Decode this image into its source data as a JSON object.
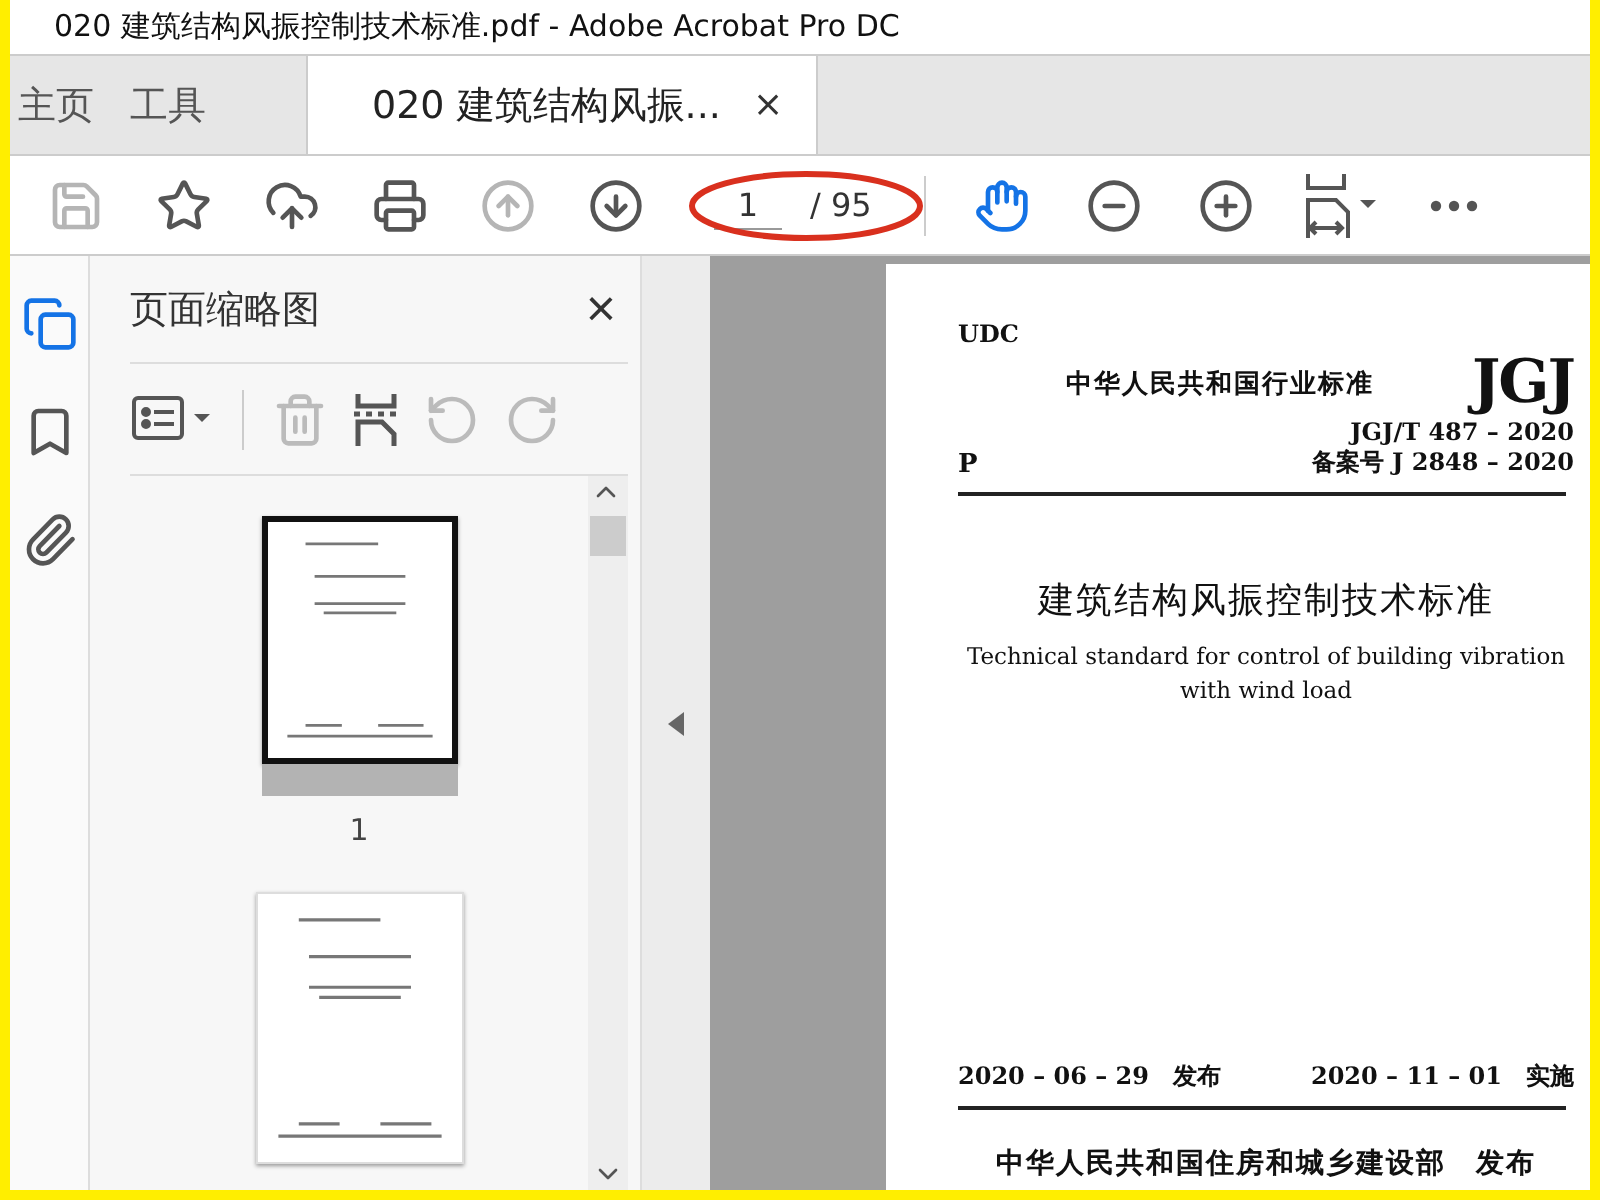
{
  "window": {
    "title": "020 建筑结构风振控制技术标准.pdf - Adobe Acrobat Pro DC"
  },
  "tabs": [
    {
      "label": "主页",
      "selected": false
    },
    {
      "label": "工具",
      "selected": false
    },
    {
      "label": "020 建筑结构风振...",
      "selected": true,
      "close": "×"
    }
  ],
  "toolbar": {
    "tools": [
      {
        "kind": "save",
        "disabled": true
      },
      {
        "kind": "star",
        "disabled": false
      },
      {
        "kind": "upload",
        "disabled": false
      },
      {
        "kind": "print",
        "disabled": false
      },
      {
        "kind": "prev",
        "disabled": true
      },
      {
        "kind": "next",
        "disabled": false
      }
    ],
    "page_number": "1",
    "page_count": "/ 95",
    "view_tools": [
      {
        "kind": "hand",
        "selected": true
      },
      {
        "kind": "zoom-out",
        "selected": false
      },
      {
        "kind": "zoom-in",
        "selected": false
      },
      {
        "kind": "fit",
        "selected": false
      },
      {
        "kind": "more",
        "selected": false
      }
    ]
  },
  "side_rail": [
    {
      "kind": "pages",
      "selected": true
    },
    {
      "kind": "bookmarks",
      "selected": false
    },
    {
      "kind": "attachments",
      "selected": false
    }
  ],
  "panel": {
    "title": "页面缩略图",
    "close": "×",
    "tools": [
      {
        "kind": "options",
        "disabled": false
      },
      {
        "kind": "delete",
        "disabled": true
      },
      {
        "kind": "insert",
        "disabled": false
      },
      {
        "kind": "rotate-left",
        "disabled": true
      },
      {
        "kind": "rotate-right",
        "disabled": true
      }
    ],
    "thumbnails": [
      {
        "label": "1",
        "selected": true
      },
      {
        "selected": false
      }
    ]
  },
  "document": {
    "udc": "UDC",
    "org": "中华人民共和国行业标准",
    "logo": "JGJ",
    "category": "P",
    "code": "JGJ/T 487 – 2020",
    "record": "备案号 J 2848 – 2020",
    "title_cn": "建筑结构风振控制技术标准",
    "title_en": "Technical standard for control of building vibration with wind load",
    "issued_date": "2020 – 06 – 29",
    "issued_label": "发布",
    "effective_date": "2020 – 11 – 01",
    "effective_label": "实施",
    "publisher": "中华人民共和国住房和城乡建设部　发布"
  }
}
